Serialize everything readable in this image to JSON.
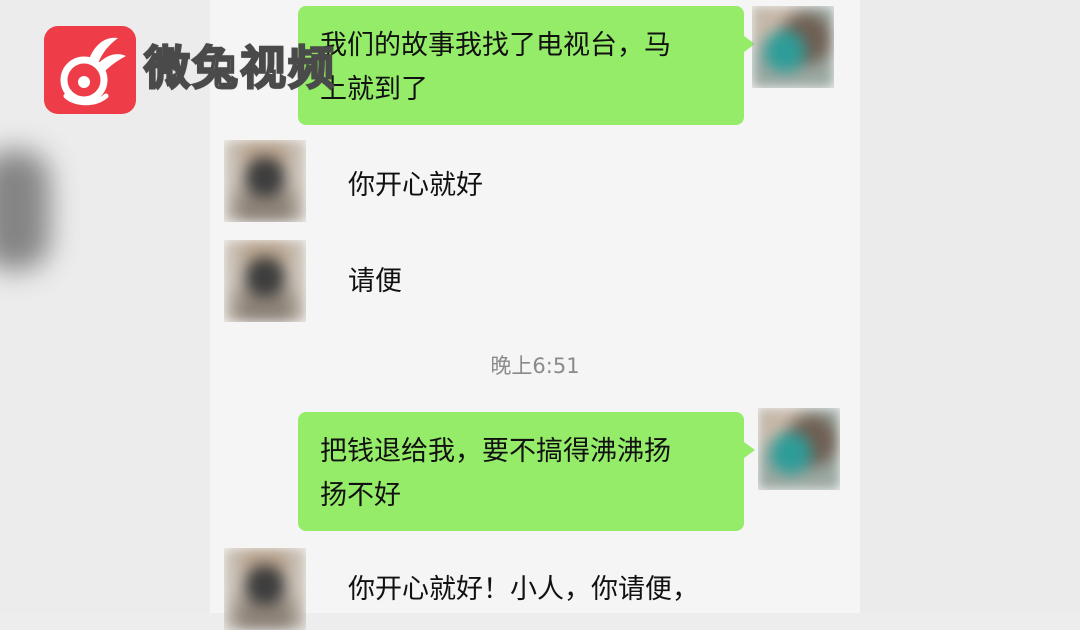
{
  "watermark": {
    "brand_name": "微兔视频",
    "icon": "rabbit-logo-icon",
    "color": "#ee3d48"
  },
  "messages": [
    {
      "side": "me",
      "text_lines": [
        "我们的故事我找了电视台，马",
        "上就到了"
      ]
    },
    {
      "side": "other",
      "text_lines": [
        "你开心就好"
      ]
    },
    {
      "side": "other",
      "text_lines": [
        "请便"
      ]
    },
    {
      "type": "timestamp",
      "text": "晚上6:51"
    },
    {
      "side": "me",
      "text_lines": [
        "把钱退给我，要不搞得沸沸扬",
        "扬不好"
      ]
    },
    {
      "side": "other",
      "text_lines": [
        "你开心就好！小人，你请便，"
      ]
    }
  ],
  "colors": {
    "my_bubble": "#95ec69",
    "chat_bg": "#f5f5f5",
    "timestamp_text": "#8a8a8a"
  }
}
